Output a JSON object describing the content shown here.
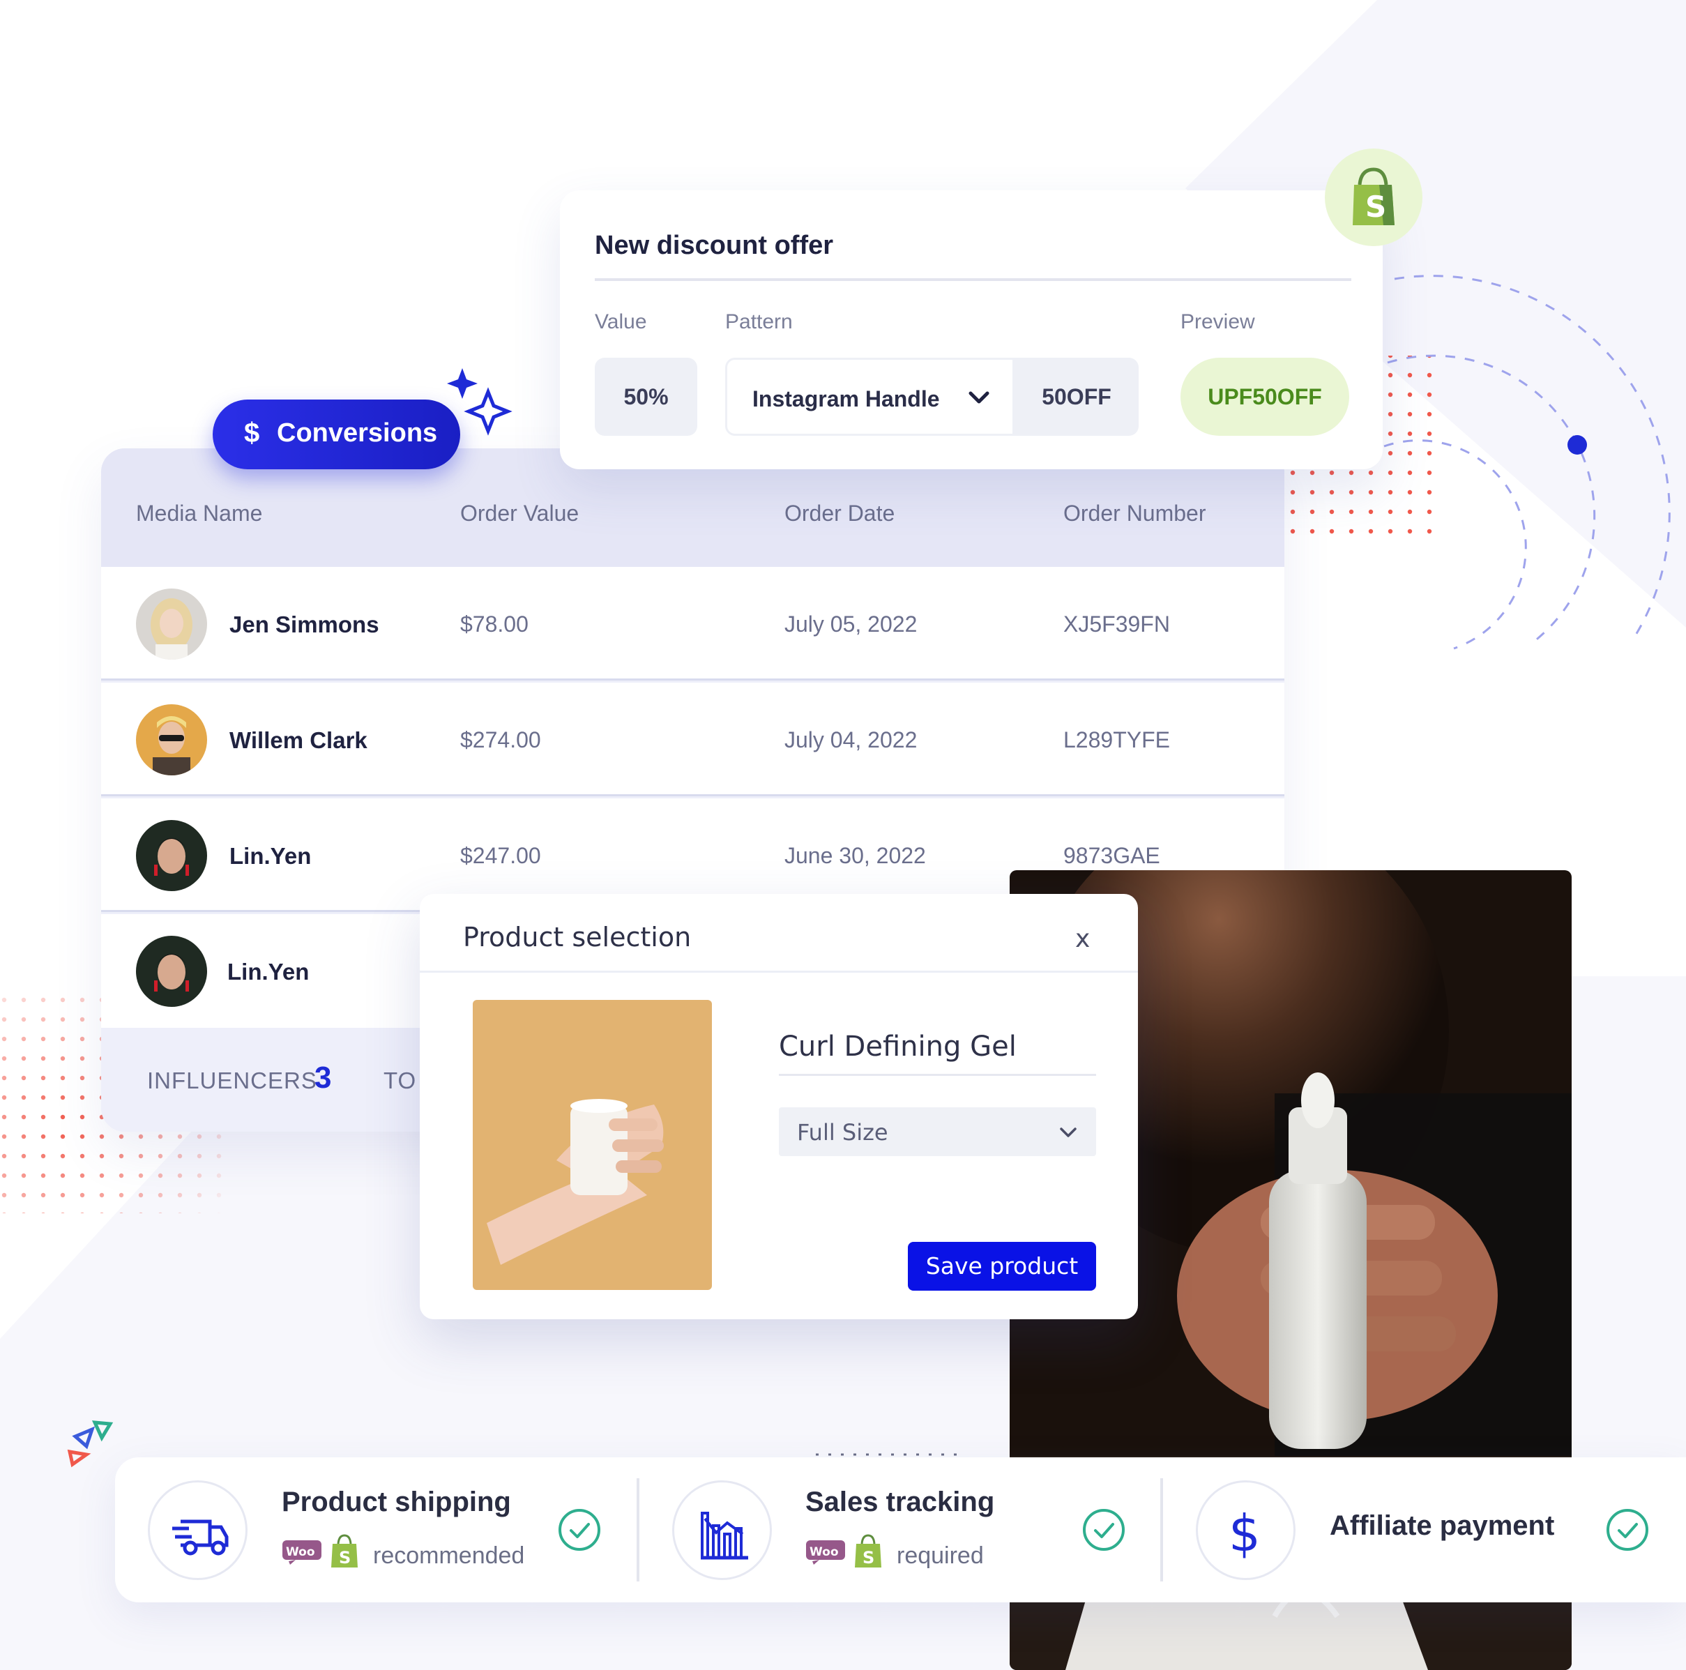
{
  "conversions_label": "Conversions",
  "conversions_icon": "dollar-icon",
  "table": {
    "headers": [
      "Media Name",
      "Order Value",
      "Order Date",
      "Order Number"
    ],
    "rows": [
      {
        "name": "Jen Simmons",
        "value": "$78.00",
        "date": "July 05, 2022",
        "number": "XJ5F39FN"
      },
      {
        "name": "Willem Clark",
        "value": "$274.00",
        "date": "July 04, 2022",
        "number": "L289TYFE"
      },
      {
        "name": "Lin.Yen",
        "value": "$247.00",
        "date": "June 30, 2022",
        "number": "9873GAE"
      },
      {
        "name": "Lin.Yen",
        "value": "",
        "date": "",
        "number": ""
      }
    ],
    "footer": {
      "influencers_label": "INFLUENCERS",
      "influencers_count": "3",
      "total_label": "TO"
    }
  },
  "discount": {
    "title": "New discount offer",
    "value_label": "Value",
    "pattern_label": "Pattern",
    "preview_label": "Preview",
    "value": "50%",
    "pattern": "Instagram Handle",
    "code": "50OFF",
    "preview": "UPF50OFF",
    "badge_icon": "shopify-bag-icon"
  },
  "modal": {
    "title": "Product selection",
    "close": "x",
    "product_name": "Curl Defining Gel",
    "size": "Full Size",
    "save": "Save product"
  },
  "features": [
    {
      "title": "Product shipping",
      "subtitle": "recommended",
      "icon": "delivery-truck-icon"
    },
    {
      "title": "Sales tracking",
      "subtitle": "required",
      "icon": "bar-chart-icon"
    },
    {
      "title": "Affiliate payment",
      "subtitle": "",
      "icon": "dollar-icon"
    }
  ],
  "colors": {
    "accent": "#1e2bd6",
    "button": "#0a12e6",
    "preview_bg": "#eaf6d4",
    "preview_text": "#4a8b1c",
    "check": "#2eae8e"
  }
}
